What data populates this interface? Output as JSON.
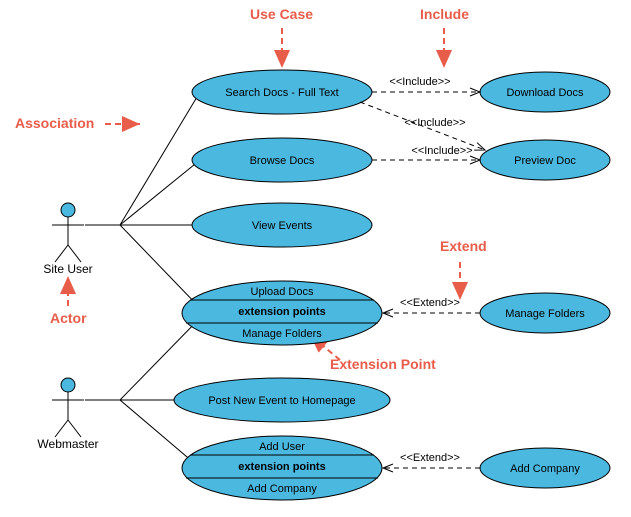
{
  "labels": {
    "use_case": "Use Case",
    "include": "Include",
    "association": "Association",
    "extend": "Extend",
    "extension_point": "Extension Point",
    "actor": "Actor"
  },
  "actors": {
    "site_user": "Site User",
    "webmaster": "Webmaster"
  },
  "usecases": {
    "search": "Search Docs - Full Text",
    "download": "Download Docs",
    "browse": "Browse Docs",
    "preview": "Preview Doc",
    "view_events": "View Events",
    "upload": "Upload Docs",
    "upload_ext_hdr": "extension points",
    "upload_ext_pt": "Manage Folders",
    "manage_folders": "Manage Folders",
    "post_event": "Post New Event to Homepage",
    "add_user": "Add User",
    "add_user_ext_hdr": "extension points",
    "add_user_ext_pt": "Add Company",
    "add_company": "Add Company"
  },
  "stereotypes": {
    "include": "<<Include>>",
    "extend": "<<Extend>>"
  },
  "chart_data": {
    "type": "uml-use-case-diagram",
    "actors": [
      "Site User",
      "Webmaster"
    ],
    "use_cases": [
      {
        "name": "Search Docs - Full Text"
      },
      {
        "name": "Download Docs"
      },
      {
        "name": "Browse Docs"
      },
      {
        "name": "Preview Doc"
      },
      {
        "name": "View Events"
      },
      {
        "name": "Upload Docs",
        "extension_points": [
          "Manage Folders"
        ]
      },
      {
        "name": "Manage Folders"
      },
      {
        "name": "Post New Event to Homepage"
      },
      {
        "name": "Add User",
        "extension_points": [
          "Add Company"
        ]
      },
      {
        "name": "Add Company"
      }
    ],
    "associations": [
      {
        "actor": "Site User",
        "use_case": "Search Docs - Full Text"
      },
      {
        "actor": "Site User",
        "use_case": "Browse Docs"
      },
      {
        "actor": "Site User",
        "use_case": "View Events"
      },
      {
        "actor": "Site User",
        "use_case": "Upload Docs"
      },
      {
        "actor": "Webmaster",
        "use_case": "Upload Docs"
      },
      {
        "actor": "Webmaster",
        "use_case": "Post New Event to Homepage"
      },
      {
        "actor": "Webmaster",
        "use_case": "Add User"
      }
    ],
    "includes": [
      {
        "from": "Search Docs - Full Text",
        "to": "Download Docs"
      },
      {
        "from": "Search Docs - Full Text",
        "to": "Preview Doc"
      },
      {
        "from": "Browse Docs",
        "to": "Preview Doc"
      }
    ],
    "extends": [
      {
        "from": "Manage Folders",
        "to": "Upload Docs"
      },
      {
        "from": "Add Company",
        "to": "Add User"
      }
    ],
    "annotations": [
      "Use Case",
      "Include",
      "Association",
      "Extend",
      "Extension Point",
      "Actor"
    ]
  }
}
